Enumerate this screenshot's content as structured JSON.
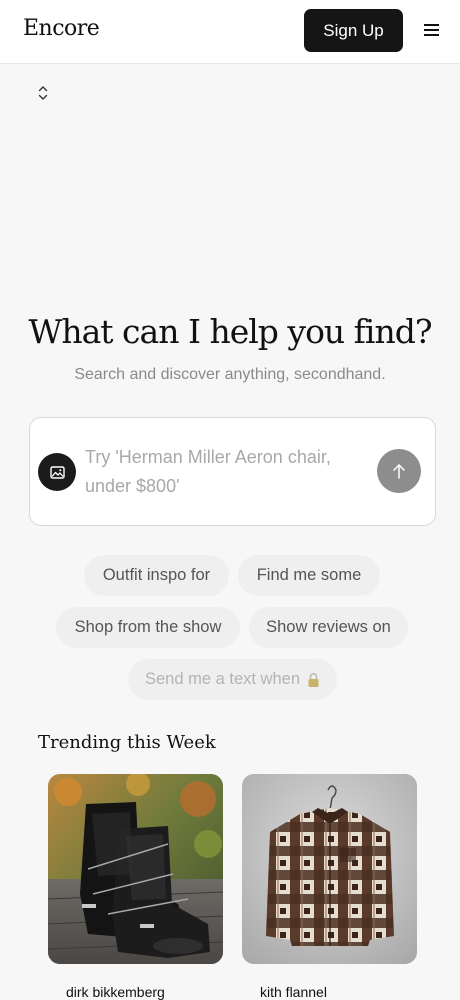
{
  "header": {
    "logo": "Encore",
    "signup_label": "Sign Up",
    "menu_icon": "hamburger-menu-icon"
  },
  "hero": {
    "title": "What can I help you find?",
    "subtitle": "Search and discover anything, secondhand."
  },
  "search": {
    "placeholder": "Try 'Herman Miller Aeron chair, under $800'",
    "image_icon": "image-upload-icon",
    "send_icon": "arrow-up-icon"
  },
  "suggestions": [
    {
      "label": "Outfit inspo for",
      "locked": false
    },
    {
      "label": "Find me some",
      "locked": false
    },
    {
      "label": "Shop from the show",
      "locked": false
    },
    {
      "label": "Show reviews on",
      "locked": false
    },
    {
      "label": "Send me a text when",
      "locked": true
    }
  ],
  "trending": {
    "title": "Trending this Week",
    "items": [
      {
        "label": "dirk bikkemberg"
      },
      {
        "label": "kith flannel"
      }
    ]
  },
  "colors": {
    "accent": "#151515",
    "background": "#f7f7f7",
    "muted_text": "#8a8a8a"
  }
}
